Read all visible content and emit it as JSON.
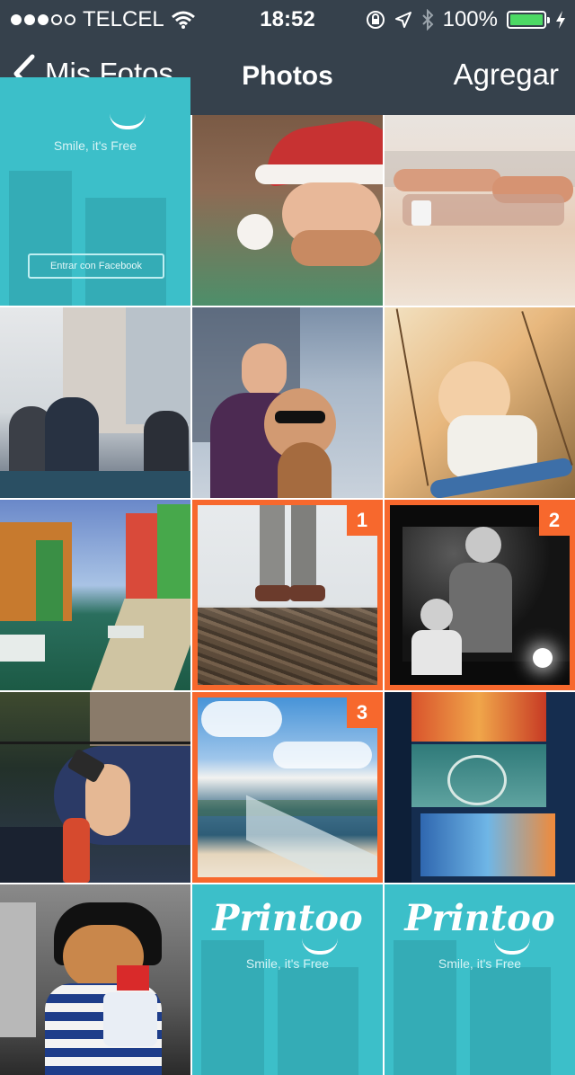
{
  "status_bar": {
    "carrier": "TELCEL",
    "time": "18:52",
    "battery": "100%",
    "signal_bars_filled": 3,
    "signal_bars_total": 5
  },
  "nav": {
    "back_label": "Mis Fotos",
    "title": "Photos",
    "add_label": "Agregar"
  },
  "colors": {
    "nav_bg": "#36414c",
    "selection": "#f7682d",
    "teal": "#3cbfc9",
    "battery": "#4cd964"
  },
  "tiles": {
    "t1_tagline": "Smile, it's Free",
    "t1_button": "Entrar con Facebook",
    "t14_logo": "Printoo",
    "t14_tagline": "Smile, it's Free",
    "t15_logo": "Printoo",
    "t15_tagline": "Smile, it's Free"
  },
  "selection": {
    "t8": "1",
    "t9": "2",
    "t11": "3"
  }
}
